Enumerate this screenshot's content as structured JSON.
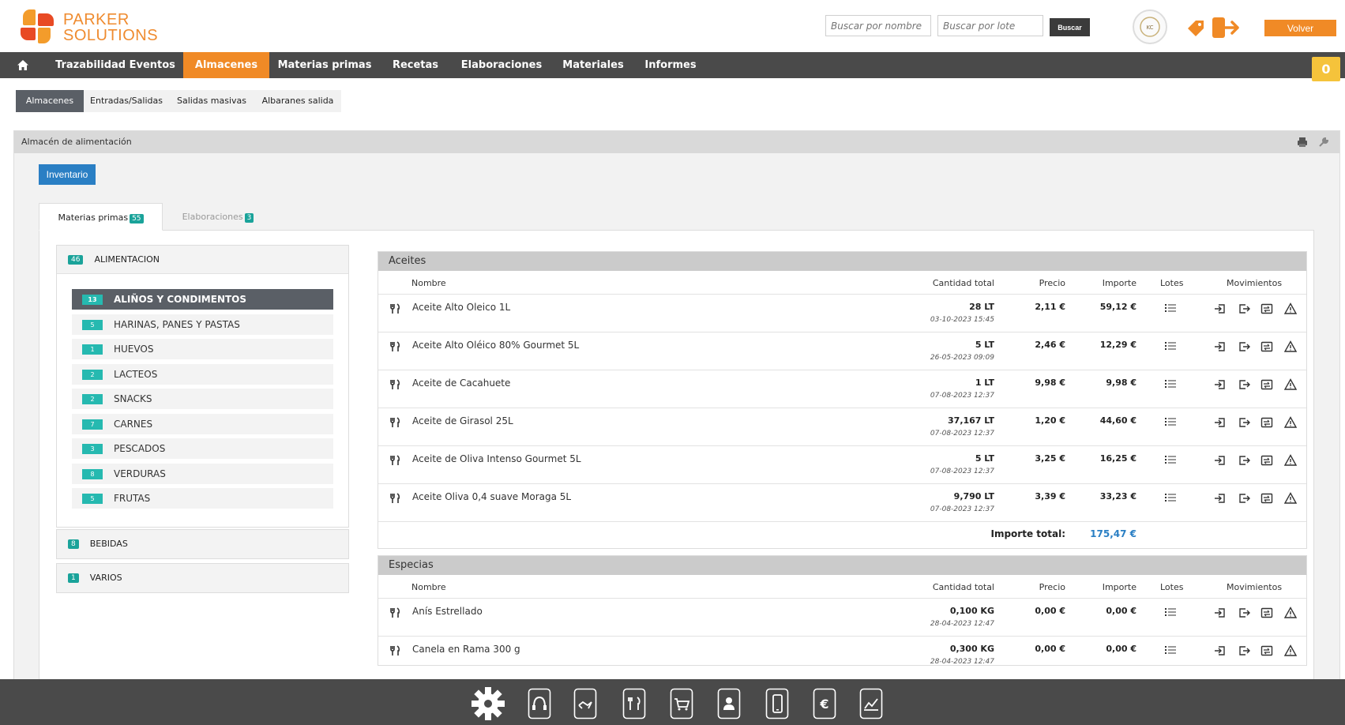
{
  "header": {
    "brand_line1": "PARKER",
    "brand_line2": "SOLUTIONS",
    "search_name_placeholder": "Buscar por nombre",
    "search_lot_placeholder": "Buscar por lote",
    "search_button": "Buscar",
    "back_button": "Volver",
    "cart_count": "0"
  },
  "nav": {
    "items": [
      "Trazabilidad Eventos",
      "Almacenes",
      "Materias primas",
      "Recetas",
      "Elaboraciones",
      "Materiales",
      "Informes"
    ],
    "active": "Almacenes"
  },
  "subnav": {
    "items": [
      "Almacenes",
      "Entradas/Salidas",
      "Salidas masivas",
      "Albaranes salida"
    ]
  },
  "panel": {
    "title": "Almacén de alimentación",
    "inventory_button": "Inventario"
  },
  "tabs": [
    {
      "label": "Materias primas",
      "count": "55"
    },
    {
      "label": "Elaboraciones",
      "count": "3"
    }
  ],
  "tree": {
    "root": {
      "label": "ALIMENTACION",
      "count": "46"
    },
    "categories": [
      {
        "label": "ALIÑOS Y CONDIMENTOS",
        "count": "13"
      },
      {
        "label": "HARINAS, PANES Y PASTAS",
        "count": "5"
      },
      {
        "label": "HUEVOS",
        "count": "1"
      },
      {
        "label": "LACTEOS",
        "count": "2"
      },
      {
        "label": "SNACKS",
        "count": "2"
      },
      {
        "label": "CARNES",
        "count": "7"
      },
      {
        "label": "PESCADOS",
        "count": "3"
      },
      {
        "label": "VERDURAS",
        "count": "8"
      },
      {
        "label": "FRUTAS",
        "count": "5"
      }
    ],
    "groups": [
      {
        "label": "BEBIDAS",
        "count": "8"
      },
      {
        "label": "VARIOS",
        "count": "1"
      }
    ]
  },
  "table": {
    "columns": {
      "name": "Nombre",
      "qty": "Cantidad total",
      "price": "Precio",
      "amount": "Importe",
      "lots": "Lotes",
      "moves": "Movimientos"
    },
    "total_label": "Importe total:"
  },
  "sections": [
    {
      "title": "Aceites",
      "rows": [
        {
          "name": "Aceite Alto Oleico 1L",
          "qty": "28 LT",
          "date": "03-10-2023 15:45",
          "price": "2,11 €",
          "amount": "59,12 €"
        },
        {
          "name": "Aceite Alto Oléico 80% Gourmet 5L",
          "qty": "5 LT",
          "date": "26-05-2023 09:09",
          "price": "2,46 €",
          "amount": "12,29 €"
        },
        {
          "name": "Aceite de Cacahuete",
          "qty": "1 LT",
          "date": "07-08-2023 12:37",
          "price": "9,98 €",
          "amount": "9,98 €"
        },
        {
          "name": "Aceite de Girasol 25L",
          "qty": "37,167 LT",
          "date": "07-08-2023 12:37",
          "price": "1,20 €",
          "amount": "44,60 €"
        },
        {
          "name": "Aceite de Oliva Intenso Gourmet 5L",
          "qty": "5 LT",
          "date": "07-08-2023 12:37",
          "price": "3,25 €",
          "amount": "16,25 €"
        },
        {
          "name": "Aceite Oliva 0,4 suave Moraga 5L",
          "qty": "9,790 LT",
          "date": "07-08-2023 12:37",
          "price": "3,39 €",
          "amount": "33,23 €"
        }
      ],
      "total": "175,47 €"
    },
    {
      "title": "Especias",
      "rows": [
        {
          "name": "Anís Estrellado",
          "qty": "0,100 KG",
          "date": "28-04-2023 12:47",
          "price": "0,00 €",
          "amount": "0,00 €"
        },
        {
          "name": "Canela en Rama 300 g",
          "qty": "0,300 KG",
          "date": "28-04-2023 12:47",
          "price": "0,00 €",
          "amount": "0,00 €"
        }
      ]
    }
  ],
  "bottom_icons": [
    "settings-icon",
    "support-icon",
    "suppliers-icon",
    "recipes-icon",
    "shopping-icon",
    "contacts-icon",
    "mobile-icon",
    "billing-icon",
    "stats-icon"
  ]
}
